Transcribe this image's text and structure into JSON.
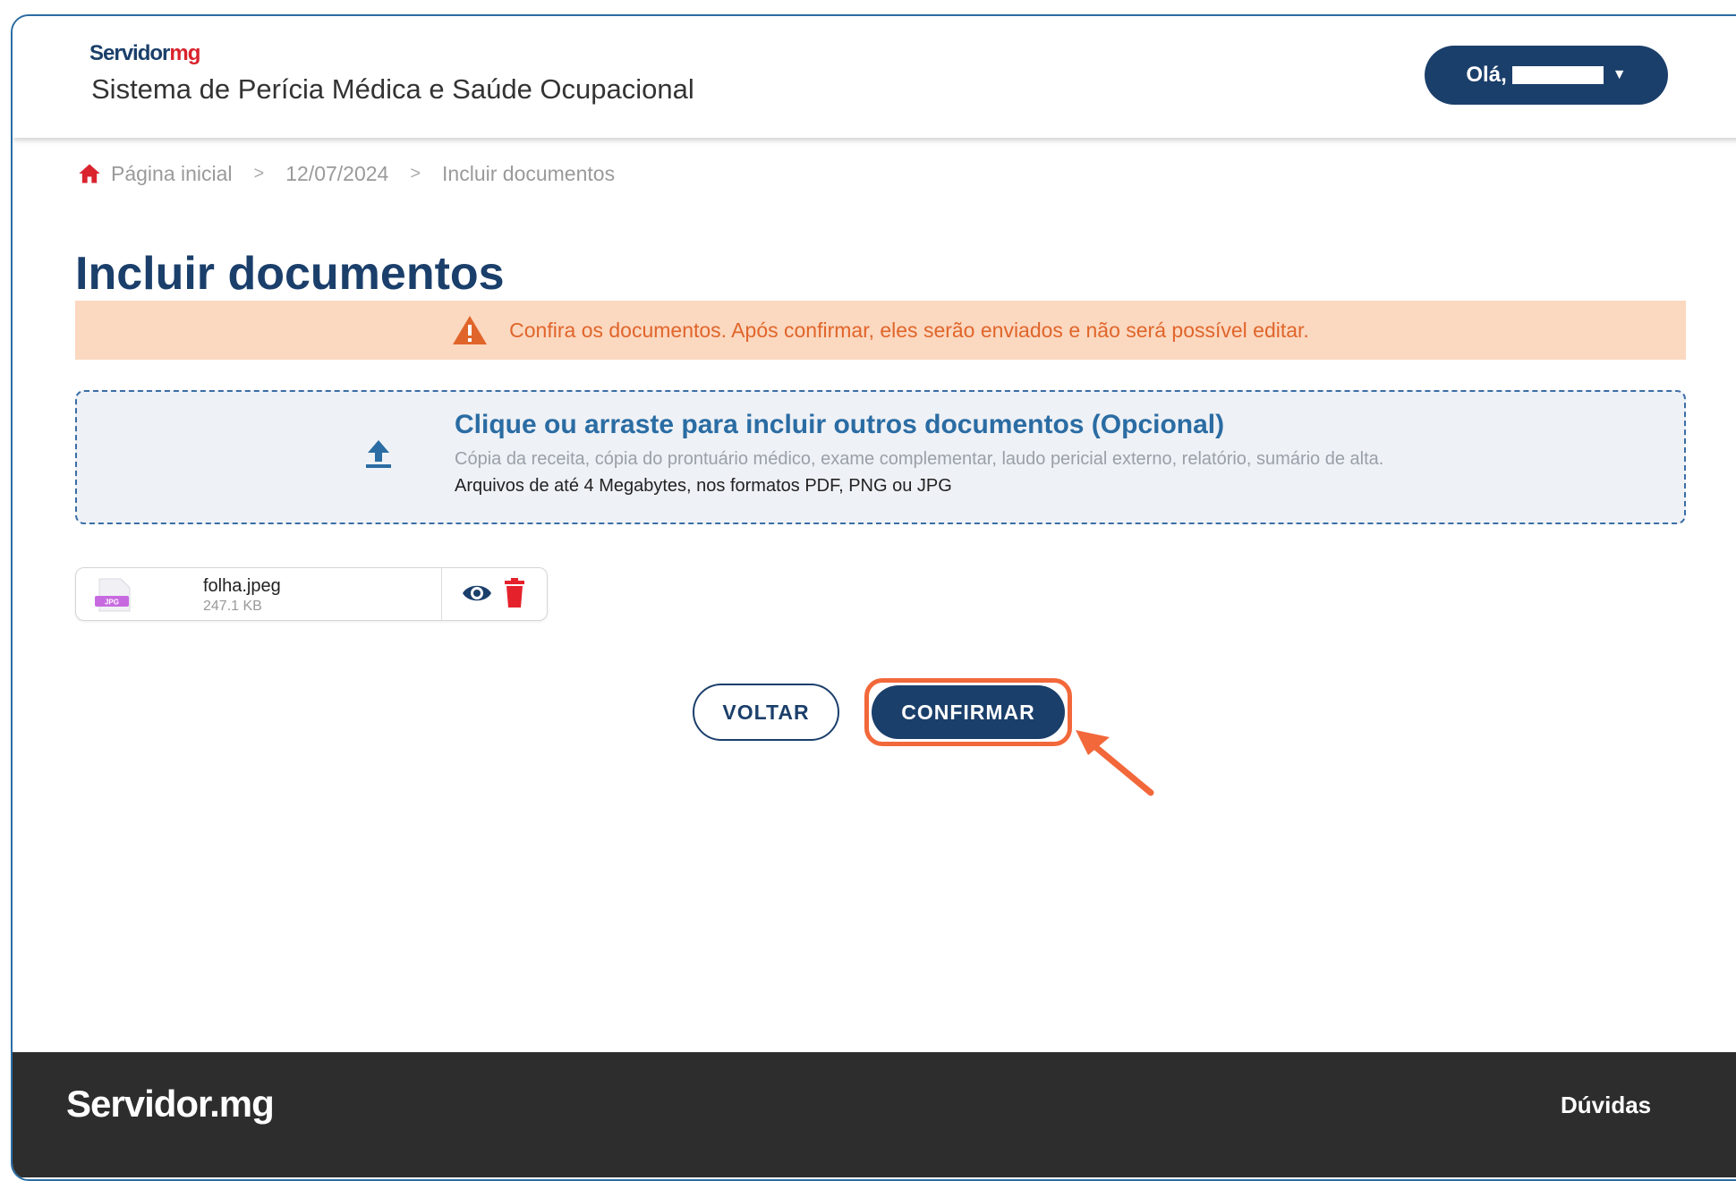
{
  "header": {
    "logo_part1": "Servidor",
    "logo_part2": "mg",
    "system_title": "Sistema de Perícia Médica e Saúde Ocupacional",
    "user_greeting": "Olá,"
  },
  "breadcrumb": {
    "home": "Página inicial",
    "separator": ">",
    "date": "12/07/2024",
    "current": "Incluir documentos"
  },
  "page": {
    "title": "Incluir documentos"
  },
  "warning": {
    "text": "Confira os documentos. Após confirmar, eles serão enviados e não será possível editar."
  },
  "dropzone": {
    "title": "Clique ou arraste para incluir outros documentos (Opcional)",
    "subtitle": "Cópia da receita, cópia do prontuário médico, exame complementar, laudo pericial externo, relatório, sumário de alta.",
    "formats": "Arquivos de até 4 Megabytes, nos formatos PDF, PNG ou JPG"
  },
  "file": {
    "icon_label": "JPG",
    "name": "folha.jpeg",
    "size": "247.1 KB"
  },
  "buttons": {
    "back": "VOLTAR",
    "confirm": "CONFIRMAR"
  },
  "footer": {
    "logo": "Servidor.mg",
    "help": "Dúvidas"
  },
  "colors": {
    "brand_blue": "#1b3f6b",
    "brand_red": "#d9232d",
    "warning_bg": "#fbd8c0",
    "warning_text": "#e0652a",
    "highlight": "#f2683a"
  }
}
